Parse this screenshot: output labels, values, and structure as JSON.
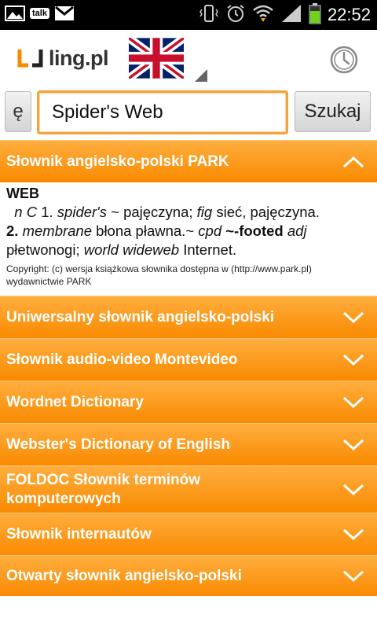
{
  "status_bar": {
    "talk_label": "talk",
    "time": "22:52"
  },
  "header": {
    "logo_text": "ling.pl",
    "flag_icon": "uk-flag-icon",
    "history_icon": "clock-icon"
  },
  "search": {
    "char_button": "ę",
    "query": "Spider's Web",
    "button_label": "Szukaj"
  },
  "dictionaries": [
    {
      "title": "Słownik angielsko-polski PARK",
      "expanded": true
    },
    {
      "title": "Uniwersalny słownik angielsko-polski",
      "expanded": false
    },
    {
      "title": "Słownik audio-video Montevideo",
      "expanded": false
    },
    {
      "title": "Wordnet Dictionary",
      "expanded": false
    },
    {
      "title": "Webster's Dictionary of English",
      "expanded": false
    },
    {
      "title": "FOLDOC Słownik terminów komputerowych",
      "expanded": false
    },
    {
      "title": "Słownik internautów",
      "expanded": false
    },
    {
      "title": "Otwarty słownik angielsko-polski",
      "expanded": false
    }
  ],
  "entry": {
    "headword": "WEB",
    "line1": {
      "pos": "n C",
      "num1": "1.",
      "term1": "spider's",
      "tilde1": "~",
      "def1": "pajęczyna;",
      "fig": "fig",
      "def1b": "sieć, pajęczyna."
    },
    "line2": {
      "num2": "2.",
      "term2": "membrane",
      "def2": "błona pławna.~",
      "cpd": "cpd",
      "footed": "~-footed",
      "adj": "adj"
    },
    "line3": {
      "def3": "płetwonogi;",
      "wwweb": "world wideweb",
      "def3b": "Internet."
    },
    "copyright": "Copyright: (c) wersja książkowa słownika dostępna w (http://www.park.pl) wydawnictwie PARK"
  },
  "colors": {
    "accent_orange": "#f98a00",
    "input_border": "#f7a13a"
  }
}
